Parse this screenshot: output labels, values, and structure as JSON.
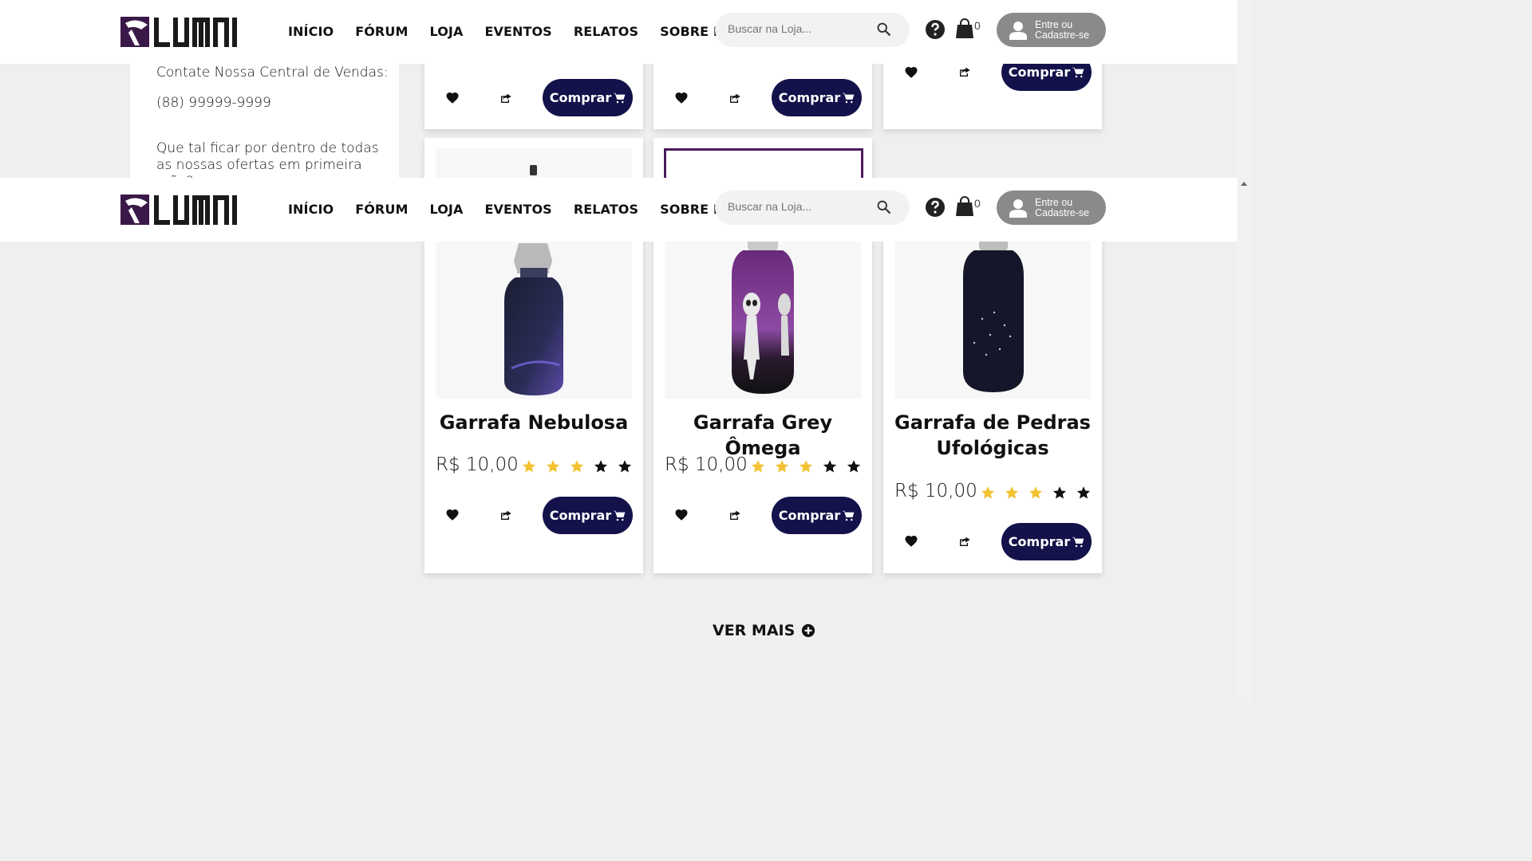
{
  "brand": {
    "logo_text": "LUMNI"
  },
  "nav": {
    "items": [
      "INÍCIO",
      "FÓRUM",
      "LOJA",
      "EVENTOS",
      "RELATOS",
      "SOBRE NÓS"
    ]
  },
  "search": {
    "placeholder": "Buscar na Loja..."
  },
  "cart": {
    "count": "0"
  },
  "login": {
    "line1": "Entre ou",
    "line2": "Cadastre-se"
  },
  "sidebar": {
    "contact_label": "Contate Nossa Central de Vendas:",
    "phone": "(88) 99999-9999",
    "promo_text": "Que tal ficar por dentro de todas as nossas ofertas em primeira mão?"
  },
  "products": [
    {
      "name": "Garrafa Nebulosa",
      "price": "R$ 10,00",
      "rating": 3,
      "max_rating": 5,
      "buy_label": "Comprar"
    },
    {
      "name": "Garrafa Grey Ômega",
      "price": "R$ 10,00",
      "rating": 3,
      "max_rating": 5,
      "buy_label": "Comprar"
    },
    {
      "name": "Garrafa de Pedras Ufológicas",
      "price": "R$ 10,00",
      "rating": 3,
      "max_rating": 5,
      "buy_label": "Comprar"
    }
  ],
  "top_row": {
    "buy_label": "Comprar"
  },
  "more": {
    "label": "VER MAIS"
  },
  "colors": {
    "accent": "#14124a",
    "star_filled": "#f2c230",
    "star_empty": "#111111",
    "brand_purple": "#4a1a5c"
  }
}
